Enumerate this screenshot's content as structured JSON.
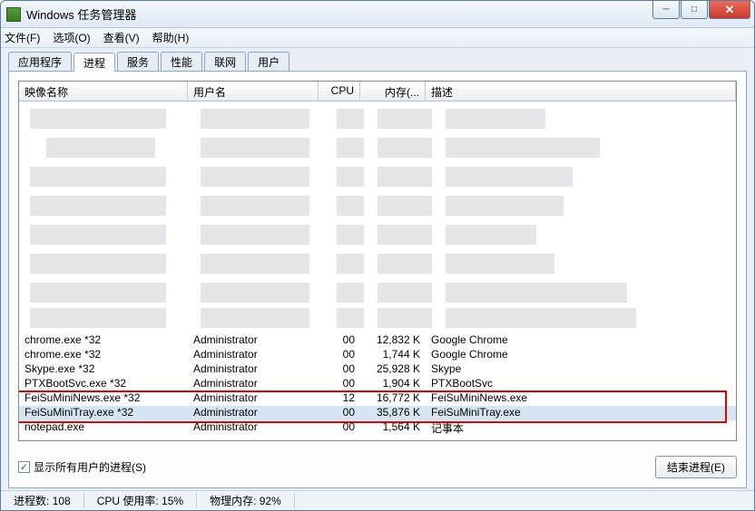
{
  "window": {
    "title": "Windows 任务管理器"
  },
  "menu": {
    "file": "文件(F)",
    "options": "选项(O)",
    "view": "查看(V)",
    "help": "帮助(H)"
  },
  "tabs": [
    "应用程序",
    "进程",
    "服务",
    "性能",
    "联网",
    "用户"
  ],
  "columns": {
    "image": "映像名称",
    "user": "用户名",
    "cpu": "CPU",
    "mem": "内存(...",
    "desc": "描述"
  },
  "rows": [
    {
      "image": "chrome.exe *32",
      "user": "Administrator",
      "cpu": "00",
      "mem": "12,832 K",
      "desc": "Google Chrome"
    },
    {
      "image": "chrome.exe *32",
      "user": "Administrator",
      "cpu": "00",
      "mem": "1,744 K",
      "desc": "Google Chrome"
    },
    {
      "image": "Skype.exe *32",
      "user": "Administrator",
      "cpu": "00",
      "mem": "25,928 K",
      "desc": "Skype"
    },
    {
      "image": "PTXBootSvc.exe *32",
      "user": "Administrator",
      "cpu": "00",
      "mem": "1,904 K",
      "desc": "PTXBootSvc"
    },
    {
      "image": "FeiSuMiniNews.exe *32",
      "user": "Administrator",
      "cpu": "12",
      "mem": "16,772 K",
      "desc": "FeiSuMiniNews.exe"
    },
    {
      "image": "FeiSuMiniTray.exe *32",
      "user": "Administrator",
      "cpu": "00",
      "mem": "35,876 K",
      "desc": "FeiSuMiniTray.exe"
    },
    {
      "image": "notepad.exe",
      "user": "Administrator",
      "cpu": "00",
      "mem": "1,564 K",
      "desc": "记事本"
    }
  ],
  "checkbox": {
    "label": "显示所有用户的进程(S)"
  },
  "buttons": {
    "end": "结束进程(E)"
  },
  "status": {
    "proc": "进程数: 108",
    "cpu": "CPU 使用率: 15%",
    "mem": "物理内存: 92%"
  }
}
